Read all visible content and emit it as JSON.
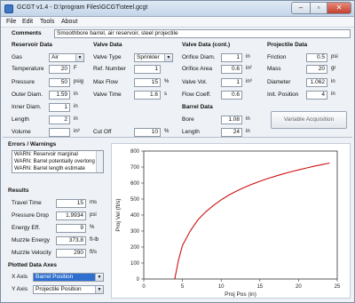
{
  "window": {
    "title": "GCGT v1.4 - D:\\program Files\\GCGT\\steel.gcgt"
  },
  "menu": [
    {
      "label": "File"
    },
    {
      "label": "Edit"
    },
    {
      "label": "Tools"
    },
    {
      "label": "About"
    }
  ],
  "comments": {
    "label": "Comments",
    "value": "Smoothbore barrel, air reservoir, steel projectile"
  },
  "reservoir": {
    "heading": "Reservoir Data",
    "gas": {
      "label": "Gas",
      "value": "Air"
    },
    "temperature": {
      "label": "Temperature",
      "value": "20",
      "unit": "F"
    },
    "pressure": {
      "label": "Pressure",
      "value": "50",
      "unit": "psig"
    },
    "outer_diam": {
      "label": "Outer Diam.",
      "value": "1.59",
      "unit": "in"
    },
    "inner_diam": {
      "label": "Inner Diam.",
      "value": "1",
      "unit": "in"
    },
    "length": {
      "label": "Length",
      "value": "2",
      "unit": "in"
    },
    "volume": {
      "label": "Volume",
      "value": "",
      "unit": "in³"
    }
  },
  "valve": {
    "heading": "Valve Data",
    "type": {
      "label": "Valve Type",
      "value": "Sprinkler"
    },
    "ref_number": {
      "label": "Ref. Number",
      "value": "1"
    },
    "max_flow": {
      "label": "Max Flow",
      "value": "15",
      "unit": "%"
    },
    "valve_time": {
      "label": "Valve Time",
      "value": "1.6",
      "unit": "s"
    },
    "cut_off": {
      "label": "Cut Off",
      "value": "10",
      "unit": "%"
    }
  },
  "valve_cont": {
    "heading": "Valve Data (cont.)",
    "orifice_diam": {
      "label": "Orifice Diam.",
      "value": "1",
      "unit": "in"
    },
    "orifice_area": {
      "label": "Orifice Area",
      "value": "0.6",
      "unit": "in²"
    },
    "valve_volume": {
      "label": "Valve Vol.",
      "value": "1",
      "unit": "in³"
    },
    "flow_coeff": {
      "label": "Flow Coeff.",
      "value": "0.6",
      "unit": ""
    },
    "eff_vol": {
      "label": "Eff. Vol.",
      "value": "",
      "unit": "in³"
    }
  },
  "barrel": {
    "heading": "Barrel Data",
    "bore": {
      "label": "Bore",
      "value": "1.08",
      "unit": "in"
    },
    "length": {
      "label": "Length",
      "value": "24",
      "unit": "in"
    }
  },
  "projectile": {
    "heading": "Projectile Data",
    "friction": {
      "label": "Friction",
      "value": "0.5",
      "unit": "psi"
    },
    "mass": {
      "label": "Mass",
      "value": "20",
      "unit": "gr"
    },
    "diameter": {
      "label": "Diameter",
      "value": "1.062",
      "unit": "in"
    },
    "init_position": {
      "label": "Init. Position",
      "value": "4",
      "unit": "in"
    },
    "button": "Variable Acquisition"
  },
  "errors": {
    "heading": "Errors / Warnings",
    "items": [
      "WARN: Reservoir marginal",
      "WARN: Barrel potentially overlong",
      "WARN: Barrel length estimate"
    ]
  },
  "results": {
    "heading": "Results",
    "travel_time": {
      "label": "Travel Time",
      "value": "15",
      "unit": "ms"
    },
    "pressure_drop": {
      "label": "Pressure Drop",
      "value": "1.9934",
      "unit": "psi"
    },
    "energy_eff": {
      "label": "Energy Eff.",
      "value": "9",
      "unit": "%"
    },
    "muzzle_energy": {
      "label": "Muzzle Energy",
      "value": "373.8",
      "unit": "ft-lb"
    },
    "muzzle_velocity": {
      "label": "Muzzle Velocity",
      "value": "290",
      "unit": "ft/s"
    }
  },
  "plotted_axes": {
    "heading": "Plotted Data Axes",
    "x_axis": {
      "label": "X Axis",
      "value": "Barrel Position"
    },
    "y_axis": {
      "label": "Y Axis",
      "value": "Projectile Position"
    }
  },
  "colors": {
    "curve": "#cc1111",
    "selection": "#2f6fd0"
  },
  "chart_data": {
    "type": "line",
    "xlabel": "Proj Pos (in)",
    "ylabel": "Proj Vel (ft/s)",
    "xlim": [
      0,
      25
    ],
    "ylim": [
      0,
      800
    ],
    "xticks": [
      0,
      5,
      10,
      15,
      20,
      25
    ],
    "yticks": [
      0,
      100,
      200,
      300,
      400,
      500,
      600,
      700,
      800
    ],
    "grid": false,
    "series": [
      {
        "x": [
          4,
          4.5,
          5,
          6,
          7,
          8,
          9,
          10,
          11,
          12,
          13,
          14,
          15,
          16,
          17,
          18,
          19,
          20,
          21,
          22,
          23,
          24
        ],
        "values": [
          0,
          120,
          210,
          300,
          370,
          420,
          460,
          495,
          525,
          550,
          573,
          593,
          611,
          628,
          643,
          657,
          670,
          682,
          694,
          705,
          715,
          725
        ]
      }
    ]
  }
}
